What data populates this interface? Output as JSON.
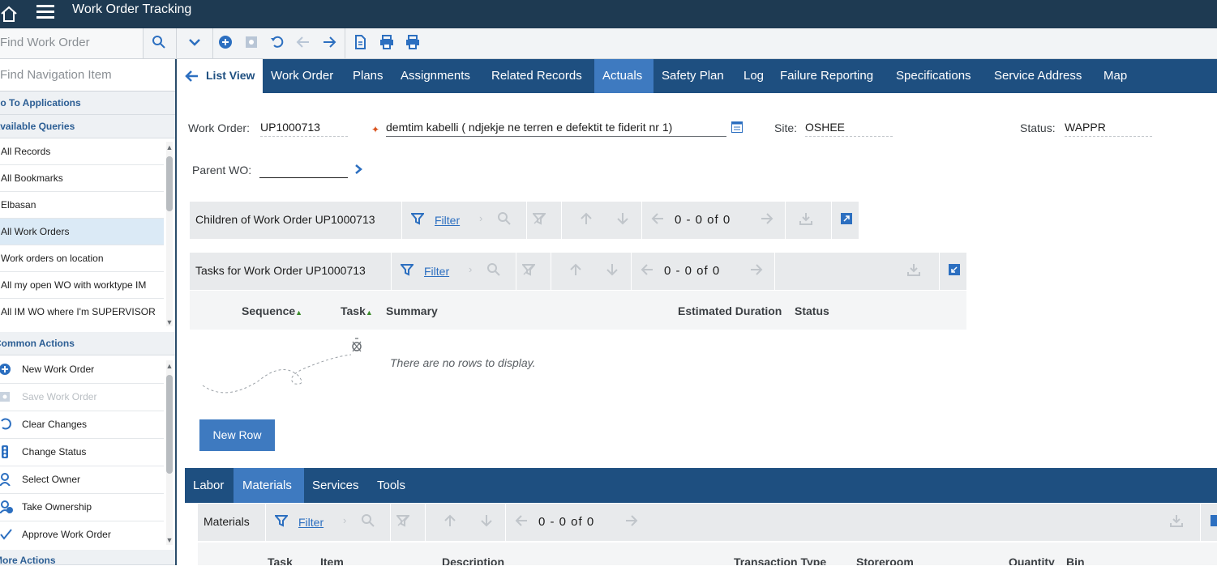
{
  "app": {
    "title": "Work Order Tracking"
  },
  "toolbar": {
    "find_placeholder": "Find Work Order"
  },
  "sidebar": {
    "find_placeholder": "Find Navigation Item",
    "go_to_applications": "Go To Applications",
    "available_queries": "Available Queries",
    "queries": [
      "All Records",
      "All Bookmarks",
      "Elbasan",
      "All Work Orders",
      "Work orders on location",
      "All my open WO with worktype IM",
      "All IM WO where I'm SUPERVISOR"
    ],
    "selected_query": "All Work Orders",
    "common_actions": "Common Actions",
    "actions": [
      "New Work Order",
      "Save Work Order",
      "Clear Changes",
      "Change Status",
      "Select Owner",
      "Take Ownership",
      "Approve Work Order"
    ],
    "more_actions": "More Actions"
  },
  "tabs": {
    "list_view": "List View",
    "items": [
      "Work Order",
      "Plans",
      "Assignments",
      "Related Records",
      "Actuals",
      "Safety Plan",
      "Log",
      "Failure Reporting",
      "Specifications",
      "Service Address",
      "Map"
    ],
    "active": "Actuals"
  },
  "form": {
    "work_order_label": "Work Order:",
    "work_order_value": "UP1000713",
    "description": "demtim kabelli ( ndjekje ne terren e defektit te fiderit nr 1)",
    "site_label": "Site:",
    "site_value": "OSHEE",
    "status_label": "Status:",
    "status_value": "WAPPR",
    "parent_label": "Parent WO:",
    "parent_value": ""
  },
  "children_table": {
    "title": "Children of Work Order UP1000713",
    "filter": "Filter",
    "pager": "0 - 0 of 0"
  },
  "tasks_table": {
    "title": "Tasks for Work Order UP1000713",
    "filter": "Filter",
    "pager": "0 - 0 of 0",
    "columns": [
      "Sequence",
      "Task",
      "Summary",
      "Estimated Duration",
      "Status"
    ],
    "empty": "There are no rows to display.",
    "new_row": "New Row"
  },
  "sub_tabs": {
    "items": [
      "Labor",
      "Materials",
      "Services",
      "Tools"
    ],
    "active": "Materials"
  },
  "materials_table": {
    "title": "Materials",
    "filter": "Filter",
    "pager": "0 - 0 of 0",
    "columns": [
      "Task",
      "Item",
      "Description",
      "Transaction Type",
      "Storeroom",
      "Quantity",
      "Bin"
    ]
  },
  "colors": {
    "topbar": "#1e3a52",
    "tabbar": "#1e4f80",
    "active_tab": "#3e7ac0",
    "accent": "#2c6fc0"
  }
}
